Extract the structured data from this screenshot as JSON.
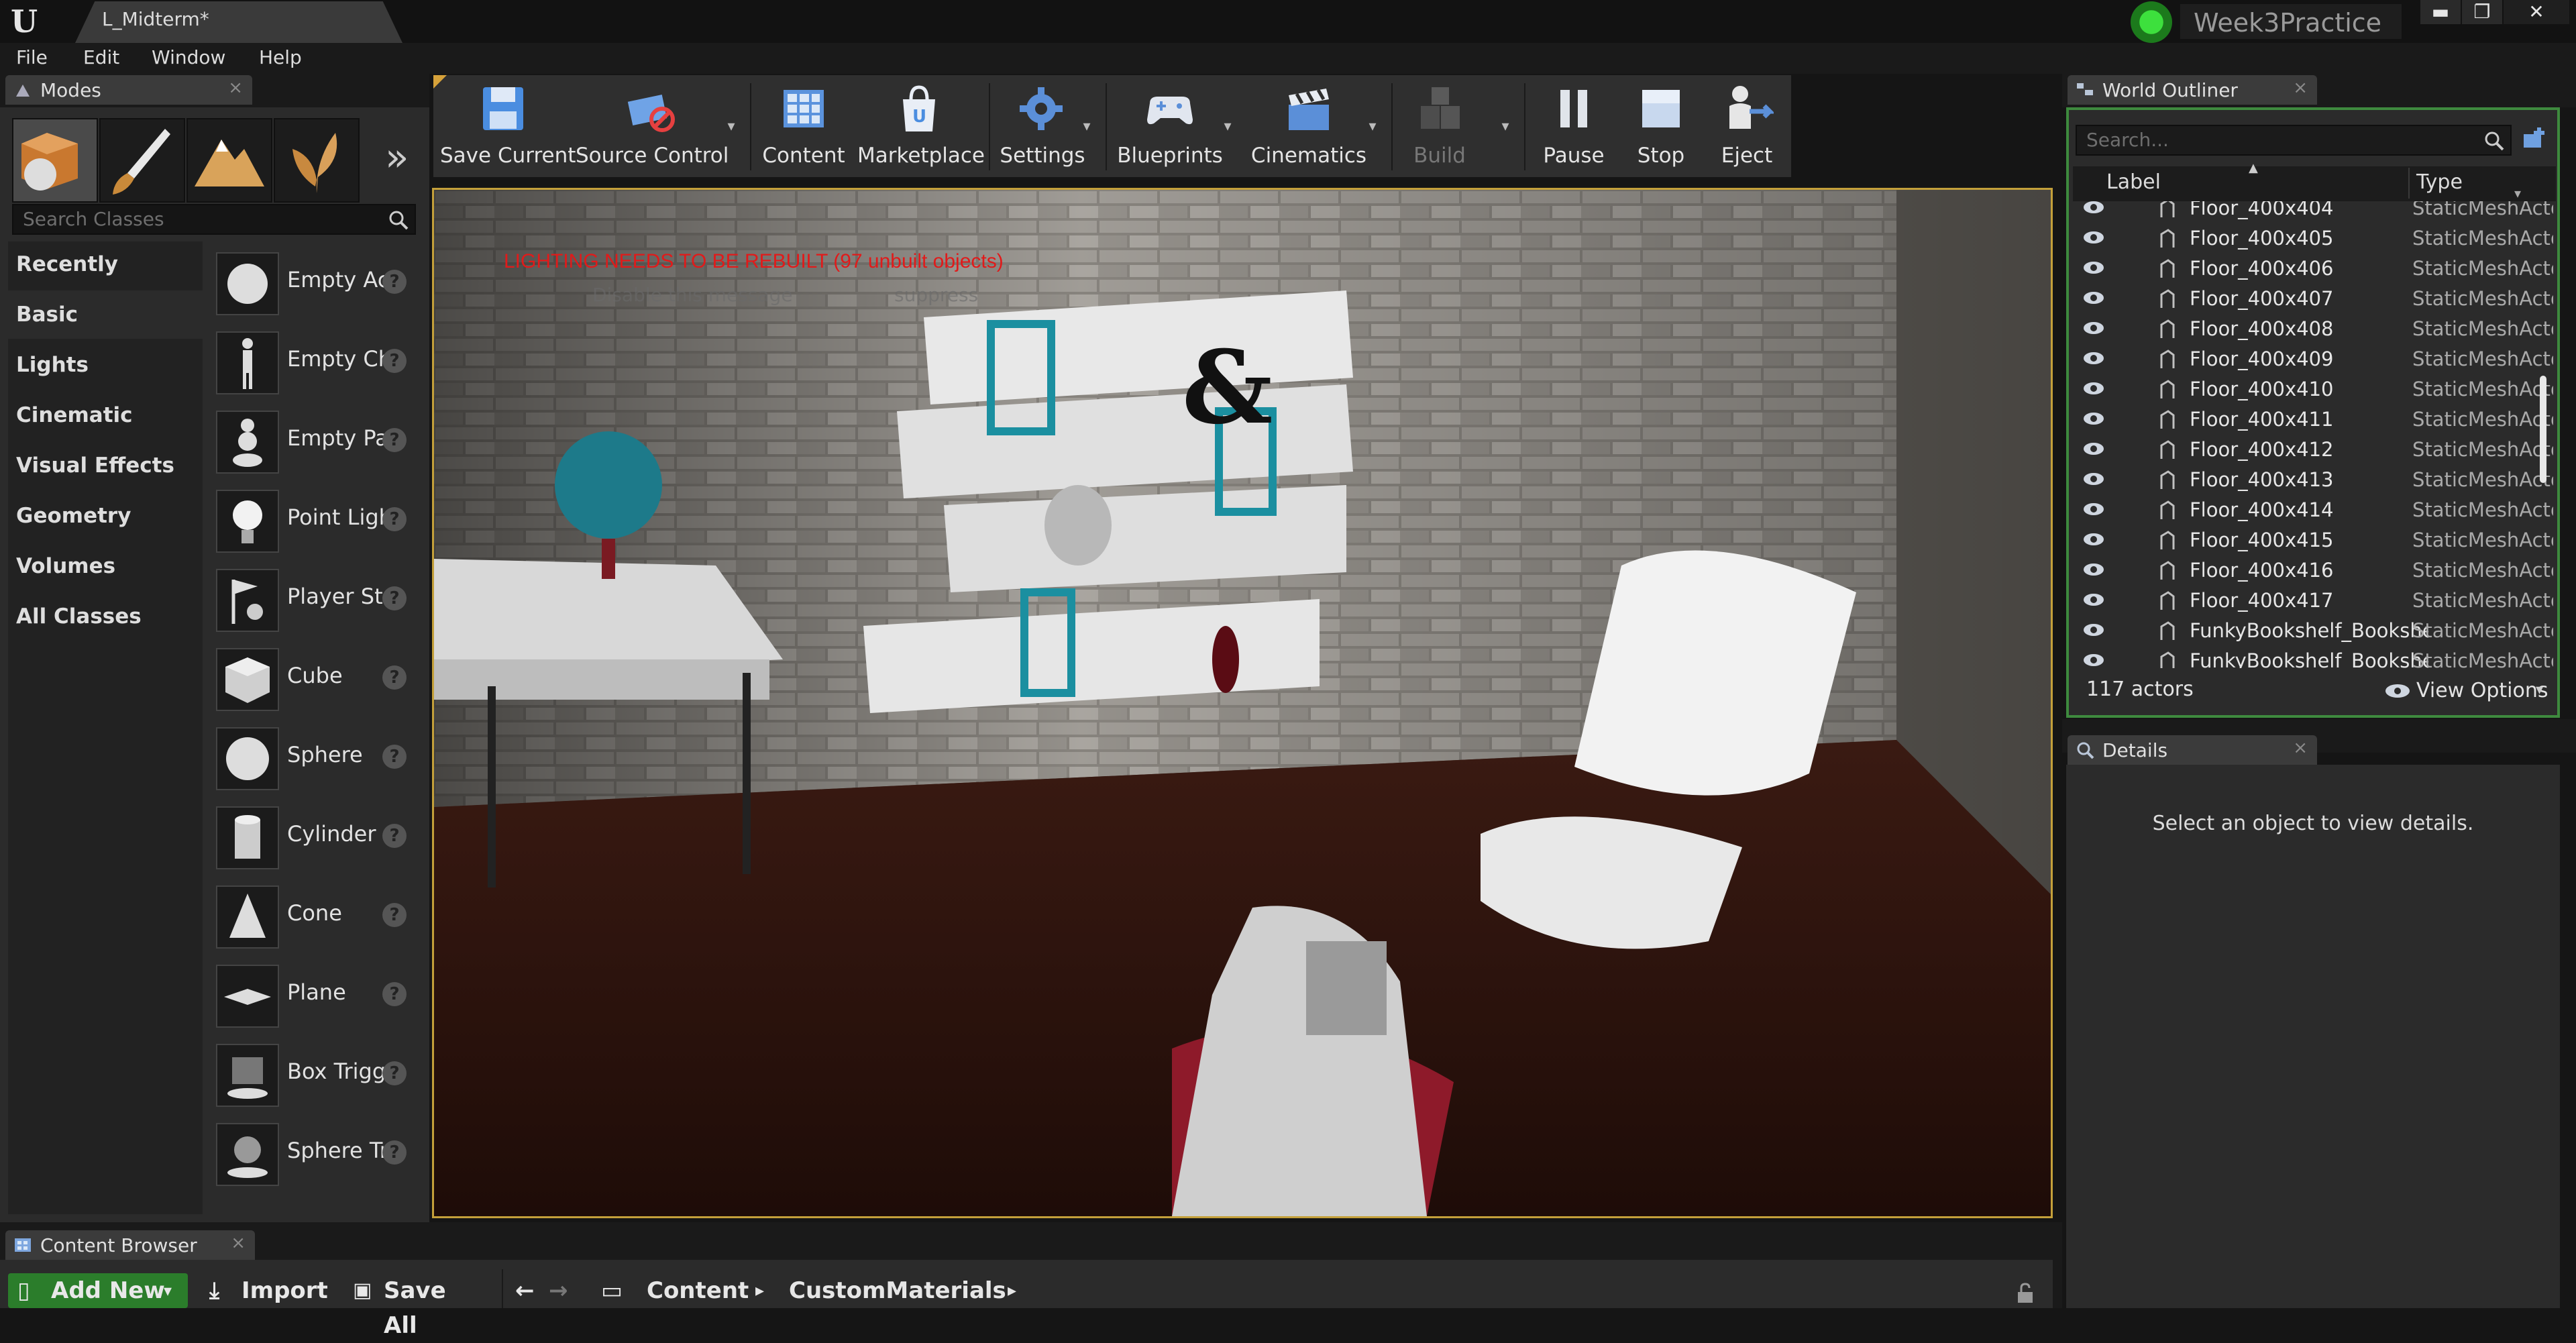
{
  "window": {
    "document_tab": "L_Midterm*",
    "project_name": "Week3Practice",
    "controls": {
      "minimize": "▬",
      "restore": "❐",
      "close": "✕"
    }
  },
  "menu": {
    "items": [
      "File",
      "Edit",
      "Window",
      "Help"
    ]
  },
  "modes": {
    "tab_label": "Modes",
    "more": "»",
    "search_placeholder": "Search Classes",
    "categories": [
      "Recently Placed",
      "Basic",
      "Lights",
      "Cinematic",
      "Visual Effects",
      "Geometry",
      "Volumes",
      "All Classes"
    ],
    "classes": [
      "Empty Actor",
      "Empty Character",
      "Empty Pawn",
      "Point Light",
      "Player Start",
      "Cube",
      "Sphere",
      "Cylinder",
      "Cone",
      "Plane",
      "Box Trigger",
      "Sphere Trigger"
    ],
    "help_glyph": "?"
  },
  "toolbar": {
    "buttons": [
      "Save Current",
      "Source Control",
      "Content",
      "Marketplace",
      "Settings",
      "Blueprints",
      "Cinematics",
      "Build",
      "Pause",
      "Stop",
      "Eject"
    ],
    "dropdown_glyph": "▾"
  },
  "viewport": {
    "warning": "LIGHTING NEEDS TO BE REBUILT (97 unbuilt objects)",
    "sub_message": "Disable this message",
    "suppress": "suppress",
    "ampersand": "&"
  },
  "outliner": {
    "tab_label": "World Outliner",
    "search_placeholder": "Search...",
    "col_label": "Label",
    "col_type": "Type",
    "sort_glyph": "▲",
    "rows": [
      {
        "label": "Floor_400x404",
        "type": "StaticMeshActor"
      },
      {
        "label": "Floor_400x405",
        "type": "StaticMeshActor"
      },
      {
        "label": "Floor_400x406",
        "type": "StaticMeshActor"
      },
      {
        "label": "Floor_400x407",
        "type": "StaticMeshActor"
      },
      {
        "label": "Floor_400x408",
        "type": "StaticMeshActor"
      },
      {
        "label": "Floor_400x409",
        "type": "StaticMeshActor"
      },
      {
        "label": "Floor_400x410",
        "type": "StaticMeshActor"
      },
      {
        "label": "Floor_400x411",
        "type": "StaticMeshActor"
      },
      {
        "label": "Floor_400x412",
        "type": "StaticMeshActor"
      },
      {
        "label": "Floor_400x413",
        "type": "StaticMeshActor"
      },
      {
        "label": "Floor_400x414",
        "type": "StaticMeshActor"
      },
      {
        "label": "Floor_400x415",
        "type": "StaticMeshActor"
      },
      {
        "label": "Floor_400x416",
        "type": "StaticMeshActor"
      },
      {
        "label": "Floor_400x417",
        "type": "StaticMeshActor"
      },
      {
        "label": "FunkyBookshelf_Bookshelf",
        "type": "StaticMeshActor"
      },
      {
        "label": "FunkyBookshelf_Bookshelf",
        "type": "StaticMeshActor"
      }
    ],
    "actor_count": "117 actors",
    "view_options": "View Options"
  },
  "details": {
    "tab_label": "Details",
    "empty_message": "Select an object to view details."
  },
  "content_browser": {
    "tab_label": "Content Browser",
    "add_new": "Add New",
    "import": "Import",
    "save_all": "Save All",
    "path": [
      "Content",
      "CustomMaterials"
    ],
    "crumb_sep": "▸"
  },
  "colors": {
    "accent_green": "#2b7d2b",
    "warning_red": "#e11a1a",
    "panel_bg": "#2b2b2b",
    "outliner_border": "#3e8a3e"
  }
}
